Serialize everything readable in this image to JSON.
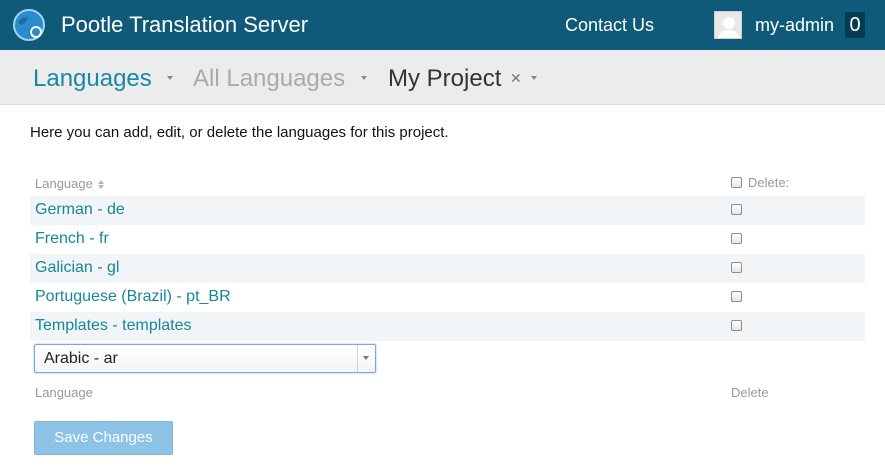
{
  "header": {
    "title": "Pootle Translation Server",
    "contact_label": "Contact Us",
    "username": "my-admin",
    "score": "0"
  },
  "breadcrumbs": [
    {
      "label": "Languages"
    },
    {
      "label": "All Languages"
    },
    {
      "label": "My Project"
    }
  ],
  "intro_text": "Here you can add, edit, or delete the languages for this project.",
  "table": {
    "columns": {
      "language": "Language",
      "delete": "Delete:"
    },
    "rows": [
      {
        "label": "German - de"
      },
      {
        "label": "French - fr"
      },
      {
        "label": "Galician - gl"
      },
      {
        "label": "Portuguese (Brazil) - pt_BR"
      },
      {
        "label": "Templates - templates"
      }
    ],
    "new_language_select": {
      "value": "Arabic - ar"
    },
    "footer": {
      "language": "Language",
      "delete": "Delete"
    }
  },
  "save_label": "Save Changes",
  "icons": {
    "logo": "pootle-globe-logo",
    "avatar": "user-avatar",
    "close": "close-icon",
    "sort": "sort-icon",
    "dropdown": "chevron-down-icon"
  },
  "colors": {
    "header_bg": "#0e5a78",
    "link": "#1a8696",
    "crumb_active": "#1a86a8",
    "save_button": "#8cc3e6"
  }
}
